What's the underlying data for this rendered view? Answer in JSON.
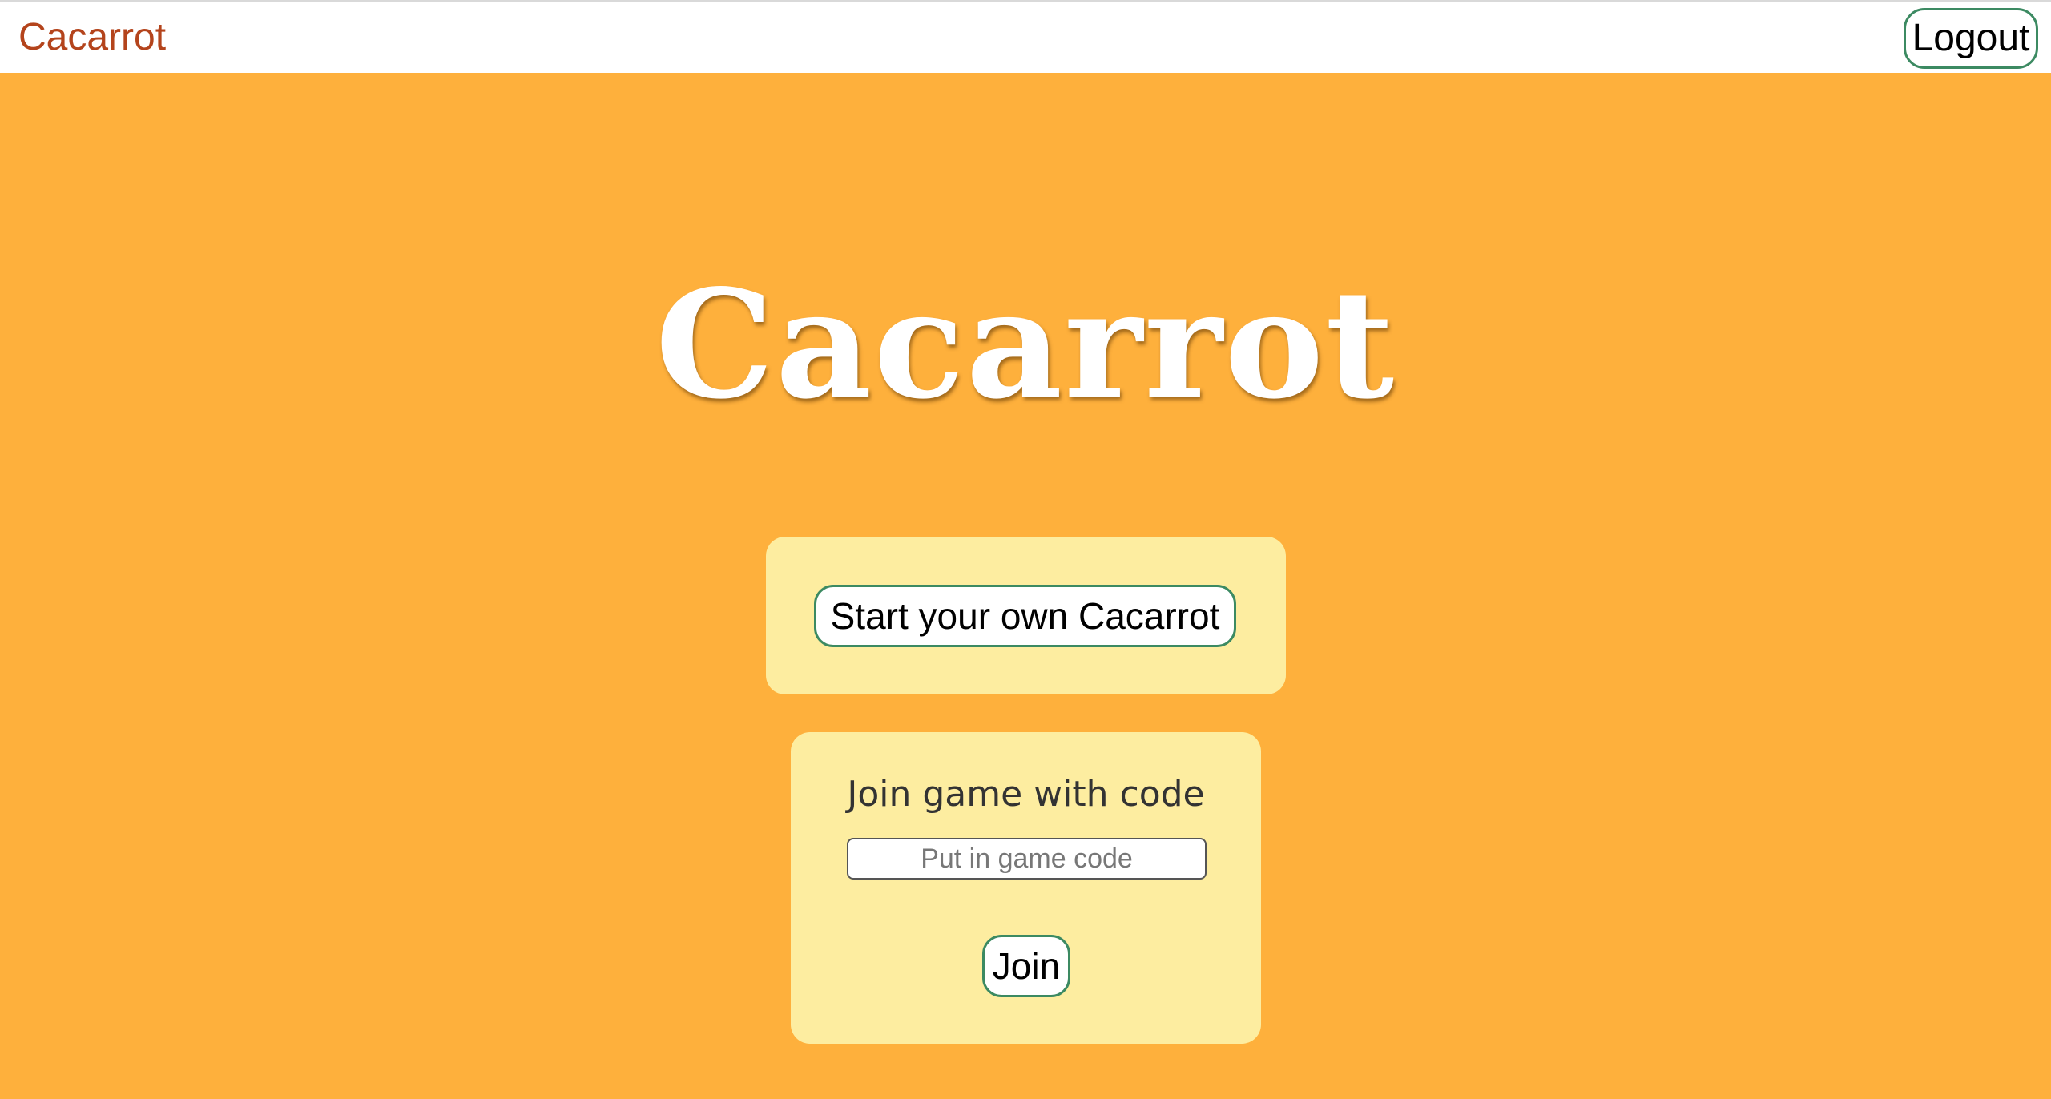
{
  "navbar": {
    "brand": "Cacarrot",
    "logout_label": "Logout"
  },
  "hero": {
    "title": "Cacarrot"
  },
  "start_card": {
    "button_label": "Start your own Cacarrot"
  },
  "join_card": {
    "heading": "Join game with code",
    "code_input": {
      "value": "",
      "placeholder": "Put in game code"
    },
    "join_label": "Join"
  },
  "colors": {
    "background": "#feb03c",
    "card": "#fdeda0",
    "brand_text": "#b4441c",
    "button_border": "#3c8a62"
  }
}
